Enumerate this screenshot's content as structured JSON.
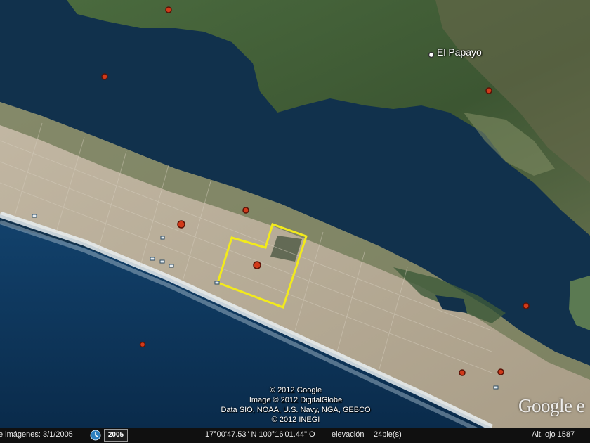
{
  "map": {
    "place_label": "El Papayo",
    "attribution": [
      "© 2012 Google",
      "Image © 2012 DigitalGlobe",
      "Data SIO, NOAA, U.S. Navy, NGA, GEBCO",
      "© 2012 INEGI"
    ],
    "logo_text": "Google e",
    "colors": {
      "water": "#0c2d4e",
      "lagoon": "#11324a",
      "sand": "#b8ad99",
      "vegetation": "#3f5a34",
      "outline": "#f2ea1c"
    }
  },
  "statusbar": {
    "imagery_date": "e imágenes: 3/1/2005",
    "year_button": "2005",
    "coordinates": "17°00'47.53\" N 100°16'01.44\" O",
    "elevation_label": "elevación",
    "elevation_value": "24pie(s)",
    "eye_alt": "Alt. ojo  1587"
  }
}
